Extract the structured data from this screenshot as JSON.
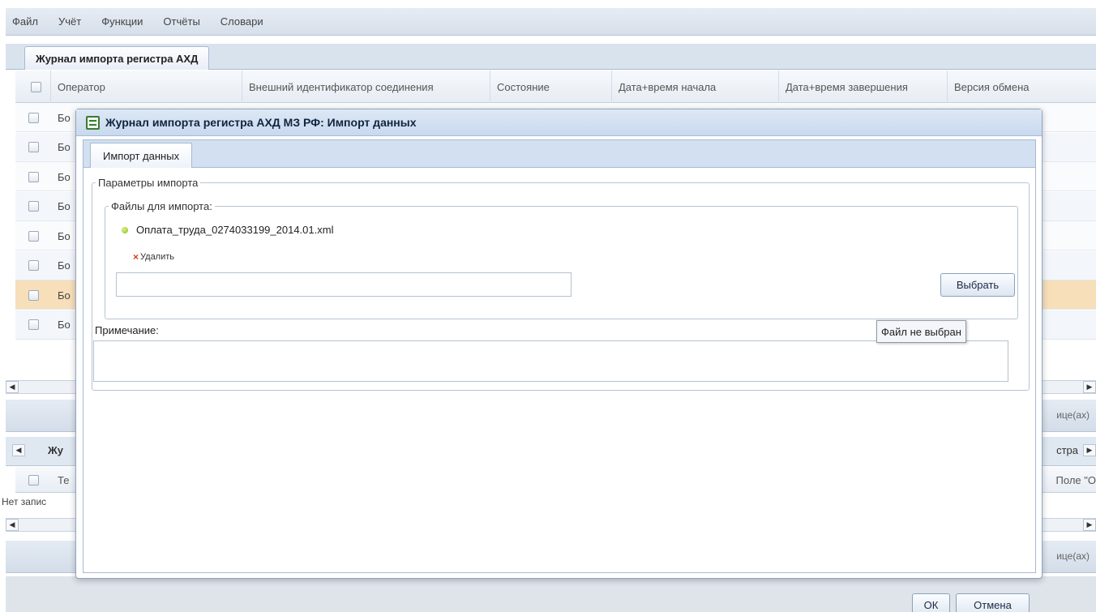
{
  "menu": [
    "Файл",
    "Учёт",
    "Функции",
    "Отчёты",
    "Словари"
  ],
  "main_tab": "Журнал импорта регистра АХД",
  "grid": {
    "columns": [
      "Оператор",
      "Внешний идентификатор соединения",
      "Состояние",
      "Дата+время начала",
      "Дата+время завершения",
      "Версия обмена"
    ],
    "row_prefix": "Бо",
    "rows": 8,
    "selected_row": 7
  },
  "pager_text": "ице(ах)",
  "tab2": {
    "label": "Жу",
    "right": "стра"
  },
  "grid2": {
    "col1": "Те",
    "right": "Поле \"О"
  },
  "no_records": "Нет запис",
  "pager2_text": "ице(ах)",
  "dialog": {
    "title": "Журнал импорта регистра АХД МЗ РФ: Импорт данных",
    "tab": "Импорт данных",
    "params_legend": "Параметры импорта",
    "files_legend": "Файлы для импорта:",
    "file_name": "Оплата_труда_0274033199_2014.01.xml",
    "delete_label": "Удалить",
    "choose_button": "Выбрать",
    "tooltip": "Файл не выбран",
    "note_label": "Примечание:",
    "ok_button": "ОК",
    "cancel_button": "Отмена"
  }
}
